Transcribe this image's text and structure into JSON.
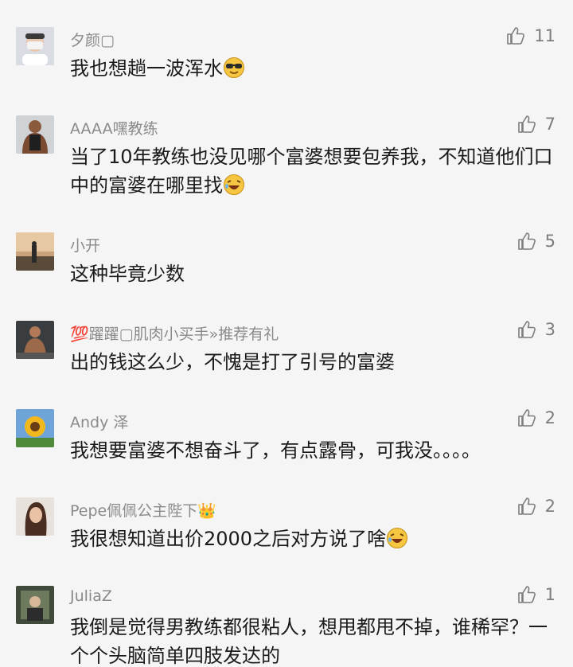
{
  "comments": [
    {
      "username": "夕颜▢",
      "text": "我也想趟一波浑水",
      "emoji": "cool-face",
      "likes": "11"
    },
    {
      "username": "AAAA嘿教练",
      "text": "当了10年教练也没见哪个富婆想要包养我，不知道他们口中的富婆在哪里找",
      "emoji": "laughing-face",
      "likes": "7"
    },
    {
      "username": "小开",
      "text": "这种毕竟少数",
      "emoji": "",
      "likes": "5"
    },
    {
      "username": "💯躍躍▢肌肉小买手»推荐有礼",
      "text": "出的钱这么少，不愧是打了引号的富婆",
      "emoji": "",
      "likes": "3"
    },
    {
      "username": "Andy 泽",
      "text": "我想要富婆不想奋斗了，有点露骨，可我没。。。。",
      "emoji": "",
      "likes": "2"
    },
    {
      "username": "Pepe佩佩公主陛下👑",
      "text": "我很想知道出价2000之后对方说了啥",
      "emoji": "laughing-face",
      "likes": "2"
    },
    {
      "username": "JuliaZ",
      "text": "我倒是觉得男教练都很粘人，想甩都甩不掉，谁稀罕？一个个头脑简单四肢发达的",
      "emoji": "",
      "likes": "1"
    }
  ],
  "icons": {
    "like": "thumbs-up-icon"
  },
  "colors": {
    "background": "#f5f5f5",
    "username": "#8a8a8a",
    "text": "#1a1a1a",
    "like": "#7d7d7d"
  }
}
